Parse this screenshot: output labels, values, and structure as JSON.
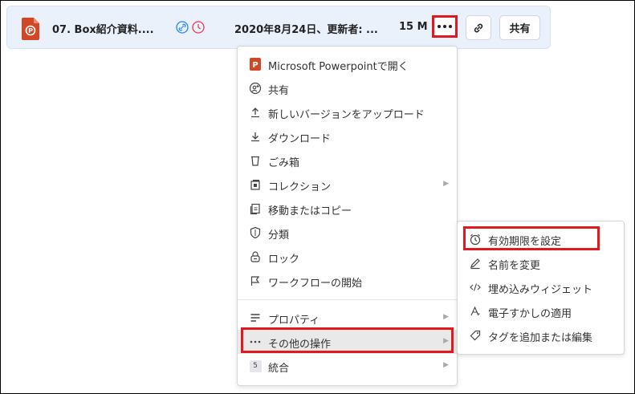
{
  "file": {
    "name": "07. Box紹介資料....",
    "updated": "2020年8月24日、更新者: ...",
    "size": "15 M",
    "share_label": "共有"
  },
  "menu": {
    "items": [
      {
        "label": "Microsoft Powerpointで開く"
      },
      {
        "label": "共有"
      },
      {
        "label": "新しいバージョンをアップロード"
      },
      {
        "label": "ダウンロード"
      },
      {
        "label": "ごみ箱"
      },
      {
        "label": "コレクション"
      },
      {
        "label": "移動またはコピー"
      },
      {
        "label": "分類"
      },
      {
        "label": "ロック"
      },
      {
        "label": "ワークフローの開始"
      },
      {
        "label": "プロパティ"
      },
      {
        "label": "その他の操作"
      },
      {
        "label": "統合",
        "badge": "5"
      }
    ]
  },
  "submenu": {
    "items": [
      {
        "label": "有効期限を設定"
      },
      {
        "label": "名前を変更"
      },
      {
        "label": "埋め込みウィジェット"
      },
      {
        "label": "電子すかしの適用"
      },
      {
        "label": "タグを追加または編集"
      }
    ]
  },
  "colors": {
    "accent_red": "#e0191f",
    "row_bg": "#eaf1fb",
    "ppt_orange": "#d24726",
    "link_blue": "#2486fc",
    "clock_pink": "#ed3757"
  },
  "icons": [
    "powerpoint-file-icon",
    "shared-link-icon",
    "expiry-clock-icon",
    "more-dots-icon",
    "link-icon"
  ]
}
